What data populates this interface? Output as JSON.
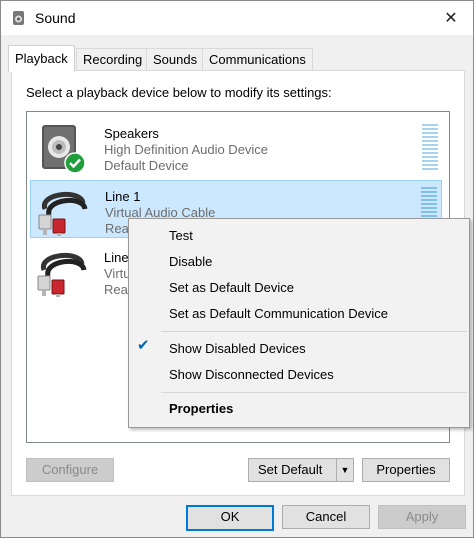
{
  "window": {
    "title": "Sound",
    "close_glyph": "✕",
    "icon": "speaker-icon"
  },
  "tabs": [
    {
      "label": "Playback",
      "active": true
    },
    {
      "label": "Recording",
      "active": false
    },
    {
      "label": "Sounds",
      "active": false
    },
    {
      "label": "Communications",
      "active": false
    }
  ],
  "instruction": "Select a playback device below to modify its settings:",
  "devices": [
    {
      "name": "Speakers",
      "description": "High Definition Audio Device",
      "status": "Default Device",
      "icon": "speaker-icon",
      "badge": "default-check-icon"
    },
    {
      "name": "Line 1",
      "description": "Virtual Audio Cable",
      "status": "Rea",
      "icon": "audio-cable-icon",
      "selected": true
    },
    {
      "name": "Line",
      "description": "Virtu",
      "status": "Rea",
      "icon": "audio-cable-icon"
    }
  ],
  "buttons": {
    "configure": "Configure",
    "set_default": "Set Default",
    "properties": "Properties",
    "ok": "OK",
    "cancel": "Cancel",
    "apply": "Apply"
  },
  "context_menu": {
    "items": [
      "Test",
      "Disable",
      "Set as Default Device",
      "Set as Default Communication Device"
    ],
    "show_disabled": "Show Disabled Devices",
    "show_disconnected": "Show Disconnected Devices",
    "properties": "Properties",
    "check_glyph": "✔"
  },
  "colors": {
    "selection": "#cce8ff",
    "accent": "#0078d7",
    "level": "#a6d3ee",
    "check_badge": "#1e9f3c"
  }
}
